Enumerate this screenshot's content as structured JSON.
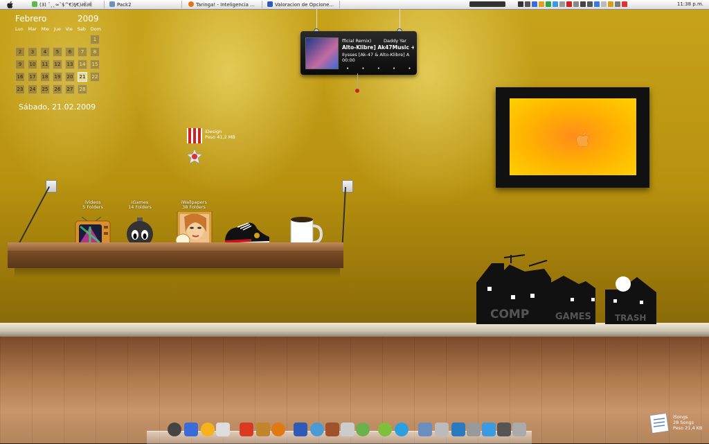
{
  "menubar": {
    "tabs": [
      {
        "label": "(3) ˇ˛˛≈ˇ$^€)§€)∂Ë∂Ë",
        "icon": "messenger-icon"
      },
      {
        "label": "Pack2",
        "icon": "folder-icon"
      },
      {
        "label": "Taringa! - Inteligencia ...",
        "icon": "firefox-icon"
      },
      {
        "label": "Valoracion de Opcione...",
        "icon": "word-icon"
      }
    ],
    "clock": "11:38 p.m."
  },
  "calendar": {
    "month": "Febrero",
    "year": "2009",
    "weekdays": [
      "Lun",
      "Mar",
      "Mie",
      "Jue",
      "Vie",
      "Sab",
      "Dom"
    ],
    "weeks": [
      [
        "",
        "",
        "",
        "",
        "",
        "",
        "1"
      ],
      [
        "2",
        "3",
        "4",
        "5",
        "6",
        "7",
        "8"
      ],
      [
        "9",
        "10",
        "11",
        "12",
        "13",
        "14",
        "15"
      ],
      [
        "16",
        "17",
        "18",
        "19",
        "20",
        "21",
        "22"
      ],
      [
        "23",
        "24",
        "25",
        "26",
        "27",
        "28",
        ""
      ]
    ],
    "today": "21",
    "date_line": "Sábado, 21.02.2009"
  },
  "itunes_widget": {
    "line1a": "fficial Remix)",
    "line1b": "Daddy Yar",
    "line2": "Alto-Klibre] Ak47Music +",
    "line3": "Ilysses [Ak-47 & Alto-Klibre] A",
    "time": "00:00",
    "dots": "• • • • •"
  },
  "desktop_folders": [
    {
      "name": "iVideos",
      "detail": "5 Folders",
      "icon": "tv-icon"
    },
    {
      "name": "iGames",
      "detail": "14 Folders",
      "icon": "bomb-icon"
    },
    {
      "name": "iWallpapers",
      "detail": "38 Folders",
      "icon": "portrait-icon"
    }
  ],
  "design_item": {
    "name": "iDesign",
    "detail": "Peso 41,2 MB",
    "icon": "medal-icon"
  },
  "isongs_item": {
    "name": "iSongs",
    "detail1": "28 Songs",
    "detail2": "Peso 21,4 KB",
    "icon": "document-icon"
  },
  "house_labels": {
    "comp": "COMP",
    "games": "GAMES",
    "trash": "TRASH"
  },
  "colors": {
    "wall": "#c7a21a",
    "frame_orange": "#ff8c1a",
    "floor": "#b07a4f"
  }
}
